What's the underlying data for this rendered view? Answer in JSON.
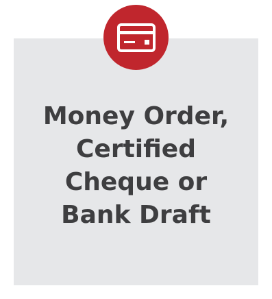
{
  "colors": {
    "card_background": "#e6e7e9",
    "badge_background": "#c0262d",
    "title_text": "#3e3e40",
    "icon_stroke": "#ffffff"
  },
  "icon": {
    "name": "credit-card-icon"
  },
  "title": {
    "lines": [
      "Money Order,",
      "Certified",
      "Cheque or",
      "Bank Draft"
    ]
  }
}
